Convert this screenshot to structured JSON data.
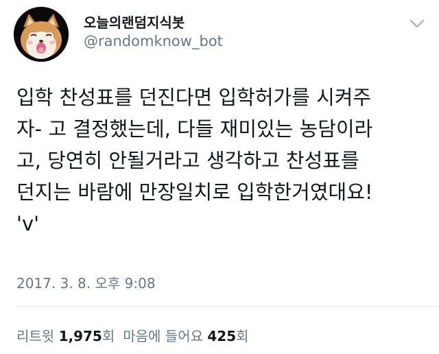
{
  "tweet": {
    "display_name": "오늘의랜덤지식봇",
    "handle": "@randomknow_bot",
    "text": "입학 찬성표를 던진다면 입학허가를 시켜주\n자- 고 결정했는데, 다들 재미있는 농담이라\n고, 당연히 안될거라고 생각하고 찬성표를\n던지는 바람에 만장일치로 입학한거였대요!\n'v'",
    "timestamp": "2017. 3. 8. 오후 9:08",
    "retweets_label": "리트윗",
    "retweets_count": "1,975",
    "retweets_unit": "회",
    "likes_label": "마음에 들어요",
    "likes_count": "425",
    "likes_unit": "회"
  },
  "icons": {
    "avatar": "shiba-dog-avatar",
    "menu": "chevron-down-icon"
  },
  "colors": {
    "text": "#14171a",
    "secondary": "#657786",
    "divider": "#e1e8ed"
  }
}
